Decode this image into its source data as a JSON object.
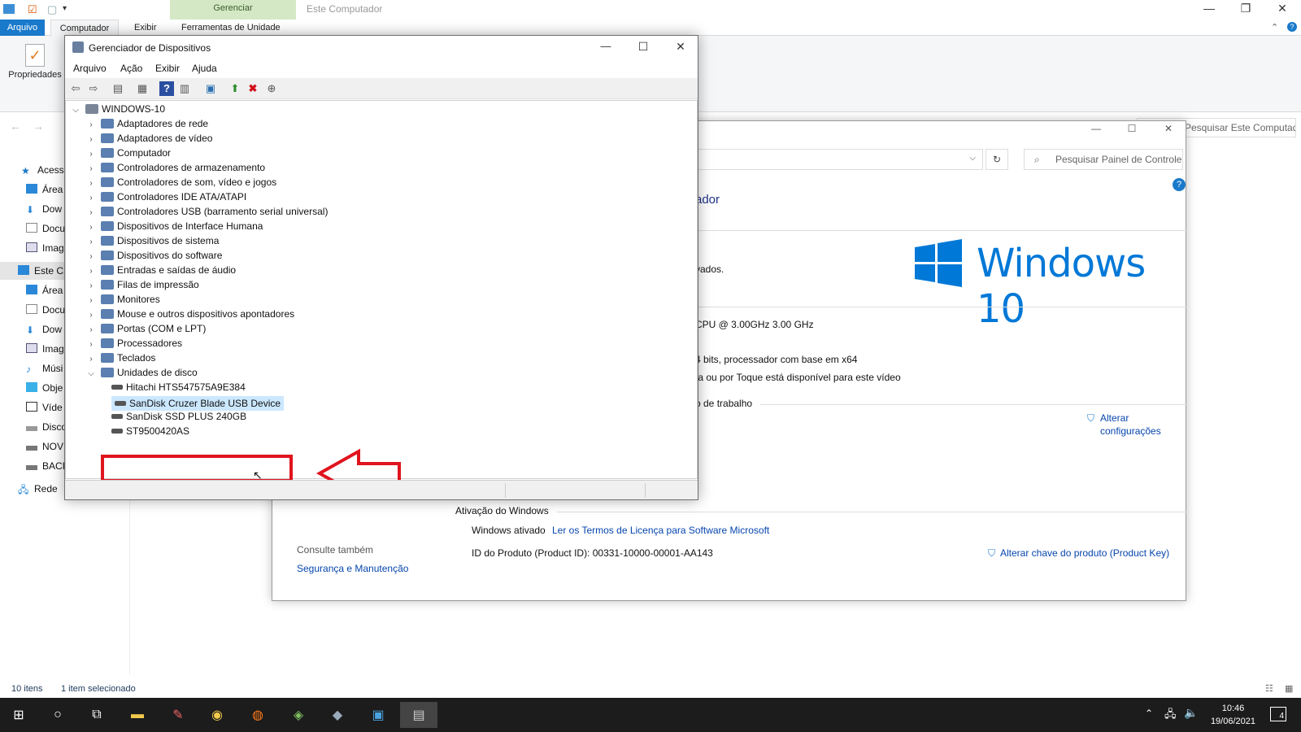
{
  "explorer": {
    "title": "Este Computador",
    "gerenciar_label": "Gerenciar",
    "tabs": [
      "Arquivo",
      "Computador",
      "Exibir",
      "Ferramentas de Unidade"
    ],
    "properties_label": "Propriedades",
    "search_placeholder": "Pesquisar Este Computador",
    "nav_items": [
      "Acesso",
      "Área",
      "Dow",
      "Docu",
      "Imag",
      "Este C",
      "Área",
      "Docu",
      "Dow",
      "Imag",
      "Músi",
      "Obje",
      "Víde",
      "Disco",
      "NOV",
      "BACI",
      "Rede"
    ],
    "status_count": "10 itens",
    "status_selected": "1 item selecionado"
  },
  "taskbar": {
    "time": "10:46",
    "date": "19/06/2021",
    "notifications": "4"
  },
  "system": {
    "search_placeholder": "Pesquisar Painel de Controle",
    "heading_fragment": "ador",
    "edition_fragment": "vados.",
    "windows_logo_text": "Windows 10",
    "cpu_fragment": "CPU @ 3.00GHz   3.00 GHz",
    "type_fragment": "4 bits, processador com base em x64",
    "pen_fragment": "ta ou por Toque está disponível para este vídeo",
    "workgroup_fragment": "o de trabalho",
    "change_settings_1": "Alterar",
    "change_settings_2": "configurações",
    "activation_heading": "Ativação do Windows",
    "activated_label": "Windows ativado",
    "license_link": "Ler os Termos de Licença para Software Microsoft",
    "product_id": "ID do Produto (Product ID):  00331-10000-00001-AA143",
    "change_key": "Alterar chave do produto (Product Key)",
    "see_also": "Consulte também",
    "security_link": "Segurança e Manutenção"
  },
  "devmgr": {
    "title": "Gerenciador de Dispositivos",
    "menu": [
      "Arquivo",
      "Ação",
      "Exibir",
      "Ajuda"
    ],
    "root": "WINDOWS-10",
    "categories": [
      "Adaptadores de rede",
      "Adaptadores de vídeo",
      "Computador",
      "Controladores de armazenamento",
      "Controladores de som, vídeo e jogos",
      "Controladores IDE ATA/ATAPI",
      "Controladores USB (barramento serial universal)",
      "Dispositivos de Interface Humana",
      "Dispositivos de sistema",
      "Dispositivos do software",
      "Entradas e saídas de áudio",
      "Filas de impressão",
      "Monitores",
      "Mouse e outros dispositivos apontadores",
      "Portas (COM e LPT)",
      "Processadores",
      "Teclados",
      "Unidades de disco"
    ],
    "disks": [
      "Hitachi HTS547575A9E384",
      "SanDisk Cruzer Blade USB Device",
      "SanDisk SSD PLUS 240GB",
      "ST9500420AS"
    ],
    "selected_index": 1
  },
  "colors": {
    "accent": "#1979ca",
    "windows_blue": "#0078d7",
    "annotation_red": "#e0141e",
    "selection": "#cce8ff"
  }
}
